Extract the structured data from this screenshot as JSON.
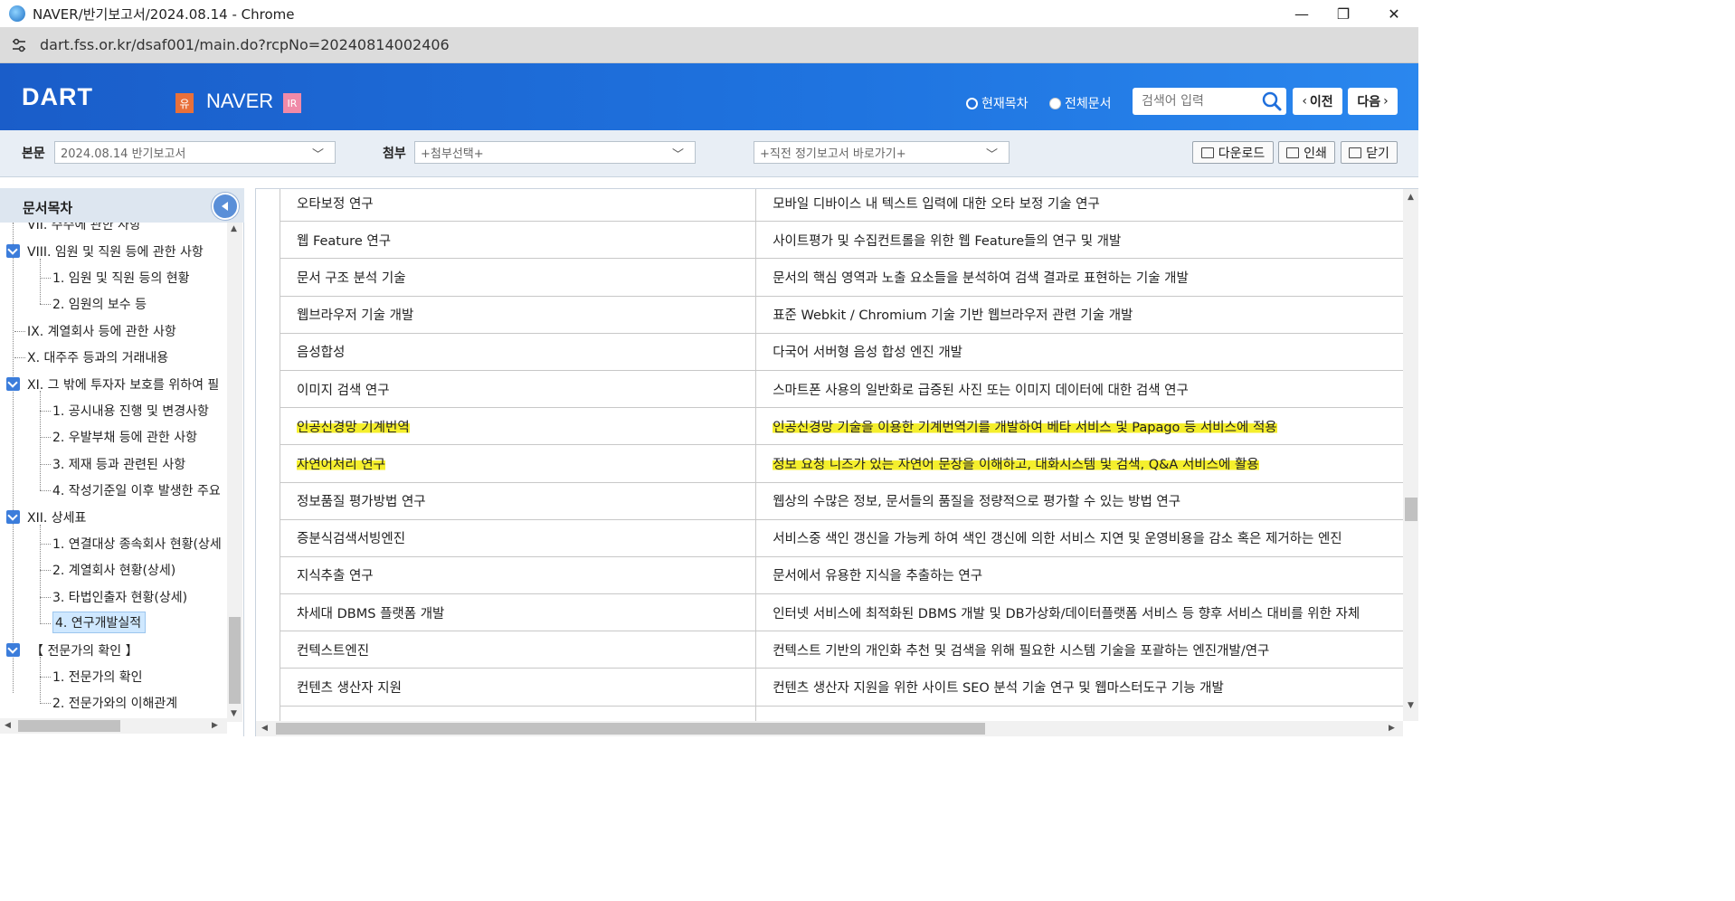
{
  "browser": {
    "window_title": "NAVER/반기보고서/2024.08.14 - Chrome",
    "url": "dart.fss.or.kr/dsaf001/main.do?rcpNo=20240814002406",
    "minimize": "—",
    "restore": "❐",
    "close": "✕"
  },
  "header": {
    "logo": "DART",
    "badge_yu": "유",
    "company": "NAVER",
    "badge_ir": "IR",
    "radio_current": "현재목차",
    "radio_all": "전체문서",
    "search_placeholder": "검색어 입력",
    "prev_label": "이전",
    "next_label": "다음"
  },
  "toolbar": {
    "main_label": "본문",
    "main_select": "2024.08.14   반기보고서",
    "attach_label": "첨부",
    "attach_select": "+첨부선택+",
    "prev_report_select": "+직전 정기보고서 바로가기+",
    "download": "다운로드",
    "print": "인쇄",
    "close": "닫기"
  },
  "sidebar": {
    "title": "문서목차",
    "items": [
      {
        "label": "VII. 주주에 관한 사항"
      },
      {
        "label": "VIII. 임원 및 직원 등에 관한 사항"
      },
      {
        "label": "1. 임원 및 직원 등의 현황"
      },
      {
        "label": "2. 임원의 보수 등"
      },
      {
        "label": "IX. 계열회사 등에 관한 사항"
      },
      {
        "label": "X. 대주주 등과의 거래내용"
      },
      {
        "label": "XI. 그 밖에 투자자 보호를 위하여 필"
      },
      {
        "label": "1. 공시내용 진행 및 변경사항"
      },
      {
        "label": "2. 우발부채 등에 관한 사항"
      },
      {
        "label": "3. 제재 등과 관련된 사항"
      },
      {
        "label": "4. 작성기준일 이후 발생한 주요"
      },
      {
        "label": "XII. 상세표"
      },
      {
        "label": "1. 연결대상 종속회사 현황(상세"
      },
      {
        "label": "2. 계열회사 현황(상세)"
      },
      {
        "label": "3. 타법인출자 현황(상세)"
      },
      {
        "label": "4. 연구개발실적"
      },
      {
        "label": "【 전문가의 확인 】"
      },
      {
        "label": "1. 전문가의 확인"
      },
      {
        "label": "2. 전문가와의 이해관계"
      }
    ]
  },
  "table": {
    "rows": [
      {
        "name": "오타보정 연구",
        "desc": "모바일 디바이스 내 텍스트 입력에 대한 오타 보정 기술 연구"
      },
      {
        "name": "웹 Feature 연구",
        "desc": "사이트평가 및 수집컨트롤을 위한 웹 Feature들의 연구 및 개발"
      },
      {
        "name": "문서 구조 분석 기술",
        "desc": "문서의 핵심 영역과 노출 요소들을 분석하여 검색 결과로 표현하는 기술 개발"
      },
      {
        "name": "웹브라우저 기술 개발",
        "desc": "표준 Webkit / Chromium 기술 기반 웹브라우저 관련 기술 개발"
      },
      {
        "name": "음성합성",
        "desc": "다국어 서버형 음성 합성 엔진 개발"
      },
      {
        "name": "이미지 검색 연구",
        "desc": "스마트폰 사용의 일반화로 급증된 사진 또는 이미지 데이터에 대한 검색 연구"
      },
      {
        "name": "인공신경망 기계번역",
        "desc": "인공신경망   기술을 이용한 기계번역기를 개발하여 베타 서비스 및 Papago 등 서비스에 적용",
        "highlighted": true
      },
      {
        "name": "자연어처리 연구",
        "desc": "정보 요청 니즈가 있는 자연어 문장을 이해하고, 대화시스템 및 검색, Q&A 서비스에 활용",
        "highlighted": true
      },
      {
        "name": "정보품질 평가방법 연구",
        "desc": "웹상의 수많은 정보, 문서들의 품질을 정량적으로 평가할 수 있는 방법 연구"
      },
      {
        "name": "증분식검색서빙엔진",
        "desc": "서비스중 색인 갱신을 가능케 하여 색인 갱신에 의한 서비스 지연 및 운영비용을 감소 혹은 제거하는 엔진"
      },
      {
        "name": "지식추출 연구",
        "desc": "문서에서 유용한 지식을 추출하는 연구"
      },
      {
        "name": "차세대 DBMS 플랫폼 개발",
        "desc": "인터넷 서비스에 최적화된 DBMS 개발 및 DB가상화/데이터플랫폼 서비스 등 향후 서비스 대비를 위한 자체"
      },
      {
        "name": "컨텍스트엔진",
        "desc": "컨텍스트 기반의 개인화 추천 및 검색을 위해 필요한 시스템 기술을 포괄하는 엔진개발/연구"
      },
      {
        "name": "컨텐츠 생산자 지원",
        "desc": "컨텐츠 생산자 지원을 위한 사이트 SEO 분석 기술 연구 및 웹마스터도구 기능 개발"
      },
      {
        "name": "",
        "desc": ""
      }
    ]
  },
  "colors": {
    "header_blue": "#1f6fdc",
    "highlight": "#f5ef2d",
    "selected_item": "#cfe8ff"
  }
}
